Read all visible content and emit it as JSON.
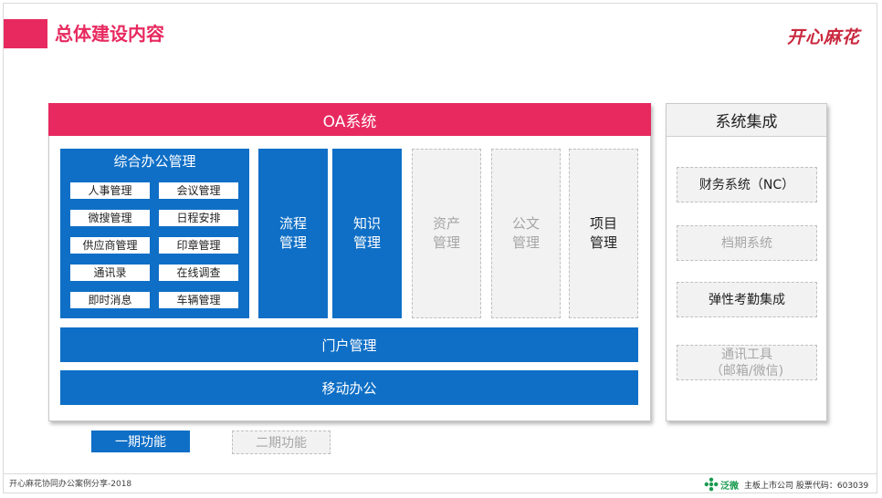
{
  "page": {
    "title": "总体建设内容",
    "logo_text": "开心麻花",
    "accent_color": "#e7295f",
    "primary_color": "#0f6fc6"
  },
  "oa": {
    "header": "OA系统",
    "office": {
      "title": "综合办公管理",
      "items": [
        "人事管理",
        "会议管理",
        "微搜管理",
        "日程安排",
        "供应商管理",
        "印章管理",
        "通讯录",
        "在线调查",
        "即时消息",
        "车辆管理"
      ]
    },
    "columns": [
      {
        "label": "流程管理",
        "phase": "一期"
      },
      {
        "label": "知识管理",
        "phase": "一期"
      },
      {
        "label": "资产管理",
        "phase": "二期"
      },
      {
        "label": "公文管理",
        "phase": "二期"
      },
      {
        "label": "项目管理",
        "phase": "其他"
      }
    ],
    "portal": "门户管理",
    "mobile": "移动办公"
  },
  "integration": {
    "header": "系统集成",
    "items": [
      {
        "label": "财务系统（NC）",
        "phase": "active"
      },
      {
        "label": "档期系统",
        "phase": "二期"
      },
      {
        "label": "弹性考勤集成",
        "phase": "active"
      },
      {
        "label": "通讯工具\n（邮箱/微信)",
        "phase": "二期"
      }
    ]
  },
  "legend": {
    "phase1": "一期功能",
    "phase2": "二期功能"
  },
  "footer": {
    "left": "开心麻花协同办公案例分享-2018",
    "brand": "泛微",
    "right": "主板上市公司  股票代码：603039"
  }
}
